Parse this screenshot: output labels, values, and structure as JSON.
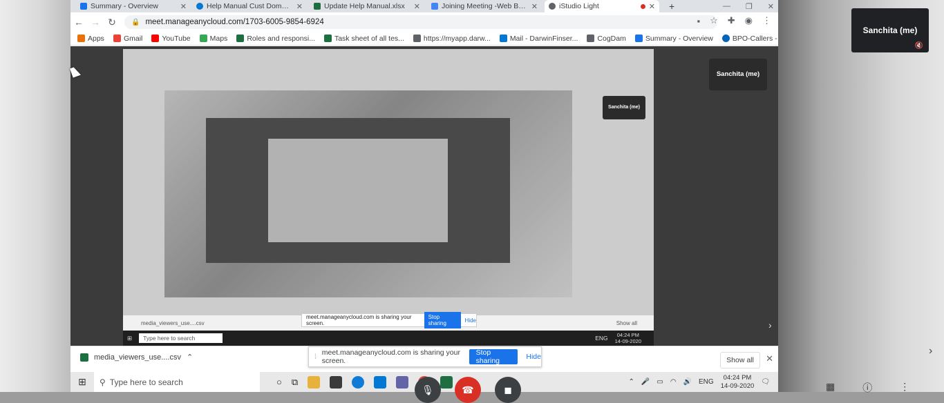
{
  "tabs": [
    {
      "title": "Summary - Overview",
      "color": "#1a73e8"
    },
    {
      "title": "Help Manual Cust Domain Link",
      "color": "#0078d4"
    },
    {
      "title": "Update Help Manual.xlsx",
      "color": "#1d6f42"
    },
    {
      "title": "Joining Meeting -Web Browser",
      "color": "#4285f4"
    },
    {
      "title": "iStudio Light",
      "color": "#5f6368"
    }
  ],
  "address": {
    "url": "meet.manageanycloud.com/1703-6005-9854-6924"
  },
  "bookmarks": [
    {
      "label": "Apps",
      "color": "#e8710a"
    },
    {
      "label": "Gmail",
      "color": "#ea4335"
    },
    {
      "label": "YouTube",
      "color": "#ff0000"
    },
    {
      "label": "Maps",
      "color": "#34a853"
    },
    {
      "label": "Roles and responsi...",
      "color": "#1d6f42"
    },
    {
      "label": "Task sheet of all tes...",
      "color": "#1d6f42"
    },
    {
      "label": "https://myapp.darw...",
      "color": "#5f6368"
    },
    {
      "label": "Mail - DarwinFinser...",
      "color": "#0078d4"
    },
    {
      "label": "CogDam",
      "color": "#5f6368"
    },
    {
      "label": "Summary - Overview",
      "color": "#1a73e8"
    },
    {
      "label": "BPO-Callers - OneD...",
      "color": "#0364b8"
    }
  ],
  "participant": {
    "name": "Sanchita (me)"
  },
  "inner": {
    "share_text": "meet.manageanycloud.com is sharing your screen.",
    "stop_label": "Stop sharing",
    "hide_label": "Hide",
    "download_file": "media_viewers_use....csv",
    "show_all": "Show all",
    "search_placeholder": "Type here to search",
    "time": "04:24 PM",
    "date": "14-09-2020",
    "lang": "ENG"
  },
  "download": {
    "file": "media_viewers_use....csv",
    "show_all": "Show all"
  },
  "sharing": {
    "text": "meet.manageanycloud.com is sharing your screen.",
    "stop": "Stop sharing",
    "hide": "Hide"
  },
  "taskbar": {
    "search_placeholder": "Type here to search",
    "lang": "ENG",
    "time": "04:24 PM",
    "date": "14-09-2020"
  }
}
